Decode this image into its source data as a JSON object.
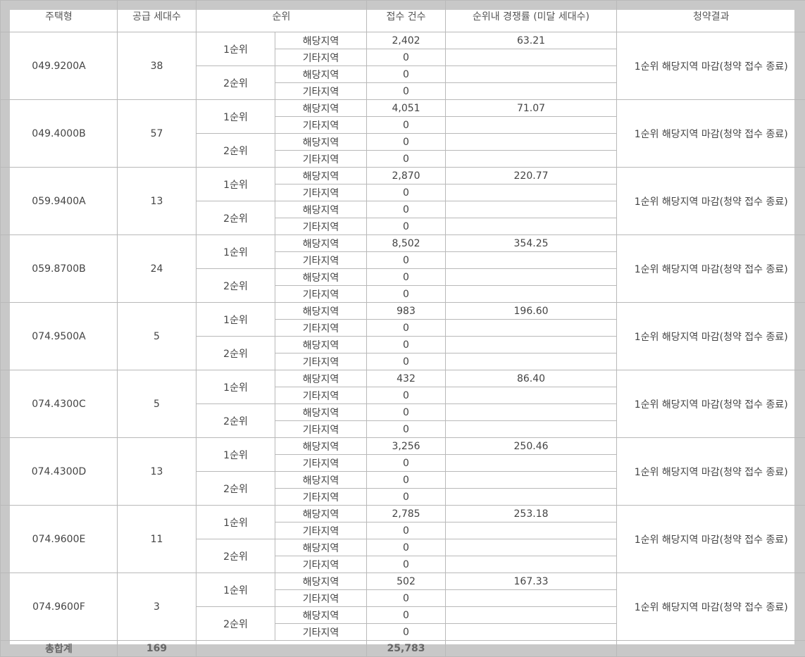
{
  "headers": {
    "type": "주택형",
    "supply": "공급 세대수",
    "rank": "순위",
    "applicants": "접수 건수",
    "ratio": "순위내 경쟁률 (미달 세대수)",
    "result": "청약결과"
  },
  "labels": {
    "rank1": "1순위",
    "rank2": "2순위",
    "local": "해당지역",
    "other": "기타지역"
  },
  "rows": [
    {
      "type": "049.9200A",
      "supply": "38",
      "r1_local": "2,402",
      "r1_other": "0",
      "r2_local": "0",
      "r2_other": "0",
      "ratio": "63.21",
      "result": "1순위 해당지역 마감(청약 접수 종료)"
    },
    {
      "type": "049.4000B",
      "supply": "57",
      "r1_local": "4,051",
      "r1_other": "0",
      "r2_local": "0",
      "r2_other": "0",
      "ratio": "71.07",
      "result": "1순위 해당지역 마감(청약 접수 종료)"
    },
    {
      "type": "059.9400A",
      "supply": "13",
      "r1_local": "2,870",
      "r1_other": "0",
      "r2_local": "0",
      "r2_other": "0",
      "ratio": "220.77",
      "result": "1순위 해당지역 마감(청약 접수 종료)"
    },
    {
      "type": "059.8700B",
      "supply": "24",
      "r1_local": "8,502",
      "r1_other": "0",
      "r2_local": "0",
      "r2_other": "0",
      "ratio": "354.25",
      "result": "1순위 해당지역 마감(청약 접수 종료)"
    },
    {
      "type": "074.9500A",
      "supply": "5",
      "r1_local": "983",
      "r1_other": "0",
      "r2_local": "0",
      "r2_other": "0",
      "ratio": "196.60",
      "result": "1순위 해당지역 마감(청약 접수 종료)"
    },
    {
      "type": "074.4300C",
      "supply": "5",
      "r1_local": "432",
      "r1_other": "0",
      "r2_local": "0",
      "r2_other": "0",
      "ratio": "86.40",
      "result": "1순위 해당지역 마감(청약 접수 종료)"
    },
    {
      "type": "074.4300D",
      "supply": "13",
      "r1_local": "3,256",
      "r1_other": "0",
      "r2_local": "0",
      "r2_other": "0",
      "ratio": "250.46",
      "result": "1순위 해당지역 마감(청약 접수 종료)"
    },
    {
      "type": "074.9600E",
      "supply": "11",
      "r1_local": "2,785",
      "r1_other": "0",
      "r2_local": "0",
      "r2_other": "0",
      "ratio": "253.18",
      "result": "1순위 해당지역 마감(청약 접수 종료)"
    },
    {
      "type": "074.9600F",
      "supply": "3",
      "r1_local": "502",
      "r1_other": "0",
      "r2_local": "0",
      "r2_other": "0",
      "ratio": "167.33",
      "result": "1순위 해당지역 마감(청약 접수 종료)"
    }
  ],
  "total": {
    "label": "총합계",
    "supply": "169",
    "applicants": "25,783"
  }
}
